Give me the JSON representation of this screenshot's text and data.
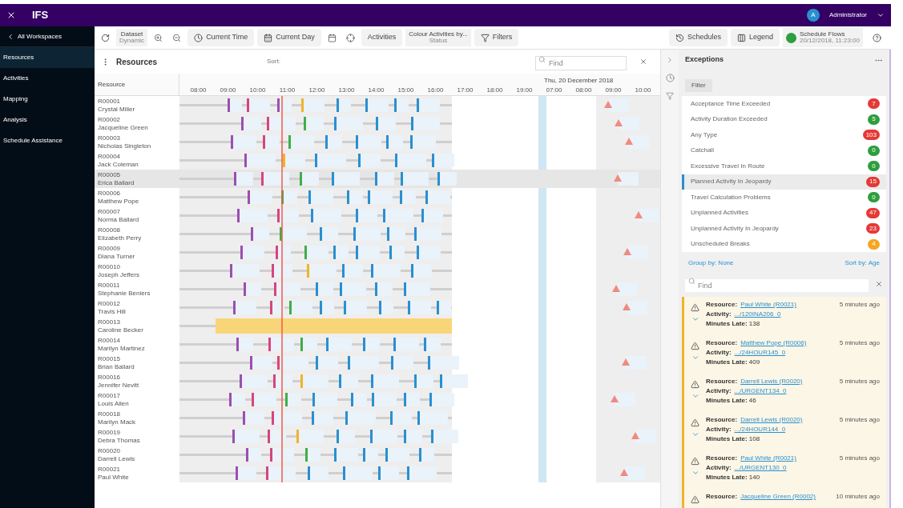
{
  "header": {
    "logo": "IFS",
    "user_initial": "A",
    "user_name": "Administrator"
  },
  "sidebar": {
    "back": "All Workspaces",
    "items": [
      {
        "label": "Resources",
        "selected": true
      },
      {
        "label": "Activities",
        "selected": false
      },
      {
        "label": "Mapping",
        "selected": false
      },
      {
        "label": "Analysis",
        "selected": false
      },
      {
        "label": "Schedule Assistance",
        "selected": false
      }
    ]
  },
  "toolbar": {
    "dataset_label": "Dataset",
    "dataset_value": "Dynamic",
    "current_time": "Current Time",
    "current_day": "Current Day",
    "activities": "Activities",
    "colour_label": "Colour Activities by...",
    "colour_value": "Status",
    "filters": "Filters",
    "schedules": "Schedules",
    "legend": "Legend",
    "flow_label": "Schedule Flows",
    "flow_value": "20/12/2018, 11:23:00"
  },
  "resources_panel": {
    "title": "Resources",
    "sort": "Sort:",
    "find_placeholder": "Find",
    "column": "Resource",
    "date": "Thu, 20 December 2018",
    "hours": [
      "08:00",
      "09:00",
      "10:00",
      "11:00",
      "12:00",
      "13:00",
      "14:00",
      "15:00",
      "16:00",
      "17:00",
      "18:00",
      "19:00",
      "07:00",
      "08:00",
      "09:00",
      "10:00"
    ],
    "rows": [
      {
        "id": "R00001",
        "name": "Crystal Miller",
        "selected": false
      },
      {
        "id": "R00002",
        "name": "Jacqueline Green",
        "selected": false
      },
      {
        "id": "R00003",
        "name": "Nicholas Singleton",
        "selected": false
      },
      {
        "id": "R00004",
        "name": "Jack Coleman",
        "selected": false
      },
      {
        "id": "R00005",
        "name": "Erica Ballard",
        "selected": true
      },
      {
        "id": "R00006",
        "name": "Matthew Pope",
        "selected": false
      },
      {
        "id": "R00007",
        "name": "Norma Ballard",
        "selected": false
      },
      {
        "id": "R00008",
        "name": "Elizabeth Perry",
        "selected": false
      },
      {
        "id": "R00009",
        "name": "Diana Turner",
        "selected": false
      },
      {
        "id": "R00010",
        "name": "Joseph Jeffers",
        "selected": false
      },
      {
        "id": "R00011",
        "name": "Stephanie Beniers",
        "selected": false
      },
      {
        "id": "R00012",
        "name": "Travis Hill",
        "selected": false
      },
      {
        "id": "R00013",
        "name": "Caroline Becker",
        "selected": false
      },
      {
        "id": "R00014",
        "name": "Marilyn Martinez",
        "selected": false
      },
      {
        "id": "R00015",
        "name": "Brian Ballard",
        "selected": false
      },
      {
        "id": "R00016",
        "name": "Jennifer Nevitt",
        "selected": false
      },
      {
        "id": "R00017",
        "name": "Louis Allen",
        "selected": false
      },
      {
        "id": "R00018",
        "name": "Marilyn Mack",
        "selected": false
      },
      {
        "id": "R00019",
        "name": "Debra Thomas",
        "selected": false
      },
      {
        "id": "R00020",
        "name": "Darrell Lewis",
        "selected": false
      },
      {
        "id": "R00021",
        "name": "Paul White",
        "selected": false
      }
    ]
  },
  "exceptions": {
    "title": "Exceptions",
    "filter": "Filter",
    "group_by": "Group by: None",
    "sort_by": "Sort by: Age",
    "find_placeholder": "Find",
    "types": [
      {
        "label": "Acceptance Time Exceeded",
        "count": "7",
        "color": "#e53935",
        "selected": false
      },
      {
        "label": "Activity Duration Exceeded",
        "count": "5",
        "color": "#2e9e3e",
        "selected": false
      },
      {
        "label": "Any Type",
        "count": "103",
        "color": "#e53935",
        "selected": false
      },
      {
        "label": "Catchall",
        "count": "0",
        "color": "#2e9e3e",
        "selected": false
      },
      {
        "label": "Excessive Travel In Route",
        "count": "0",
        "color": "#2e9e3e",
        "selected": false
      },
      {
        "label": "Planned Activity In Jeopardy",
        "count": "15",
        "color": "#e53935",
        "selected": true
      },
      {
        "label": "Travel Calculation Problems",
        "count": "0",
        "color": "#2e9e3e",
        "selected": false
      },
      {
        "label": "Unplanned Activities",
        "count": "47",
        "color": "#e53935",
        "selected": false
      },
      {
        "label": "Unplanned Activity In Jeopardy",
        "count": "23",
        "color": "#e53935",
        "selected": false
      },
      {
        "label": "Unscheduled Breaks",
        "count": "4",
        "color": "#f5a623",
        "selected": false
      }
    ],
    "alerts": [
      {
        "resource_label": "Resource:",
        "resource": "Paul White (R0021)",
        "activity_label": "Activity:",
        "activity": ".../120INA206_0",
        "late_label": "Minutes Late:",
        "late": "138",
        "age": "5 minutes ago"
      },
      {
        "resource_label": "Resource:",
        "resource": "Matthew Pope (R0006)",
        "activity_label": "Activity:",
        "activity": ".../24HOUR145_0",
        "late_label": "Minutes Late:",
        "late": "409",
        "age": "5 minutes ago"
      },
      {
        "resource_label": "Resource:",
        "resource": "Darrell Lewis (R0020)",
        "activity_label": "Activity:",
        "activity": ".../URGENT134_0",
        "late_label": "Minutes Late:",
        "late": "46",
        "age": "5 minutes ago"
      },
      {
        "resource_label": "Resource:",
        "resource": "Darrell Lewis (R0020)",
        "activity_label": "Activity:",
        "activity": ".../24HOUR144_0",
        "late_label": "Minutes Late:",
        "late": "108",
        "age": "5 minutes ago"
      },
      {
        "resource_label": "Resource:",
        "resource": "Paul White (R0021)",
        "activity_label": "Activity:",
        "activity": ".../URGENT130_0",
        "late_label": "Minutes Late:",
        "late": "140",
        "age": "5 minutes ago"
      },
      {
        "resource_label": "Resource:",
        "resource": "Jacqueline Green (R0002)",
        "age": "10 minutes ago"
      }
    ]
  }
}
